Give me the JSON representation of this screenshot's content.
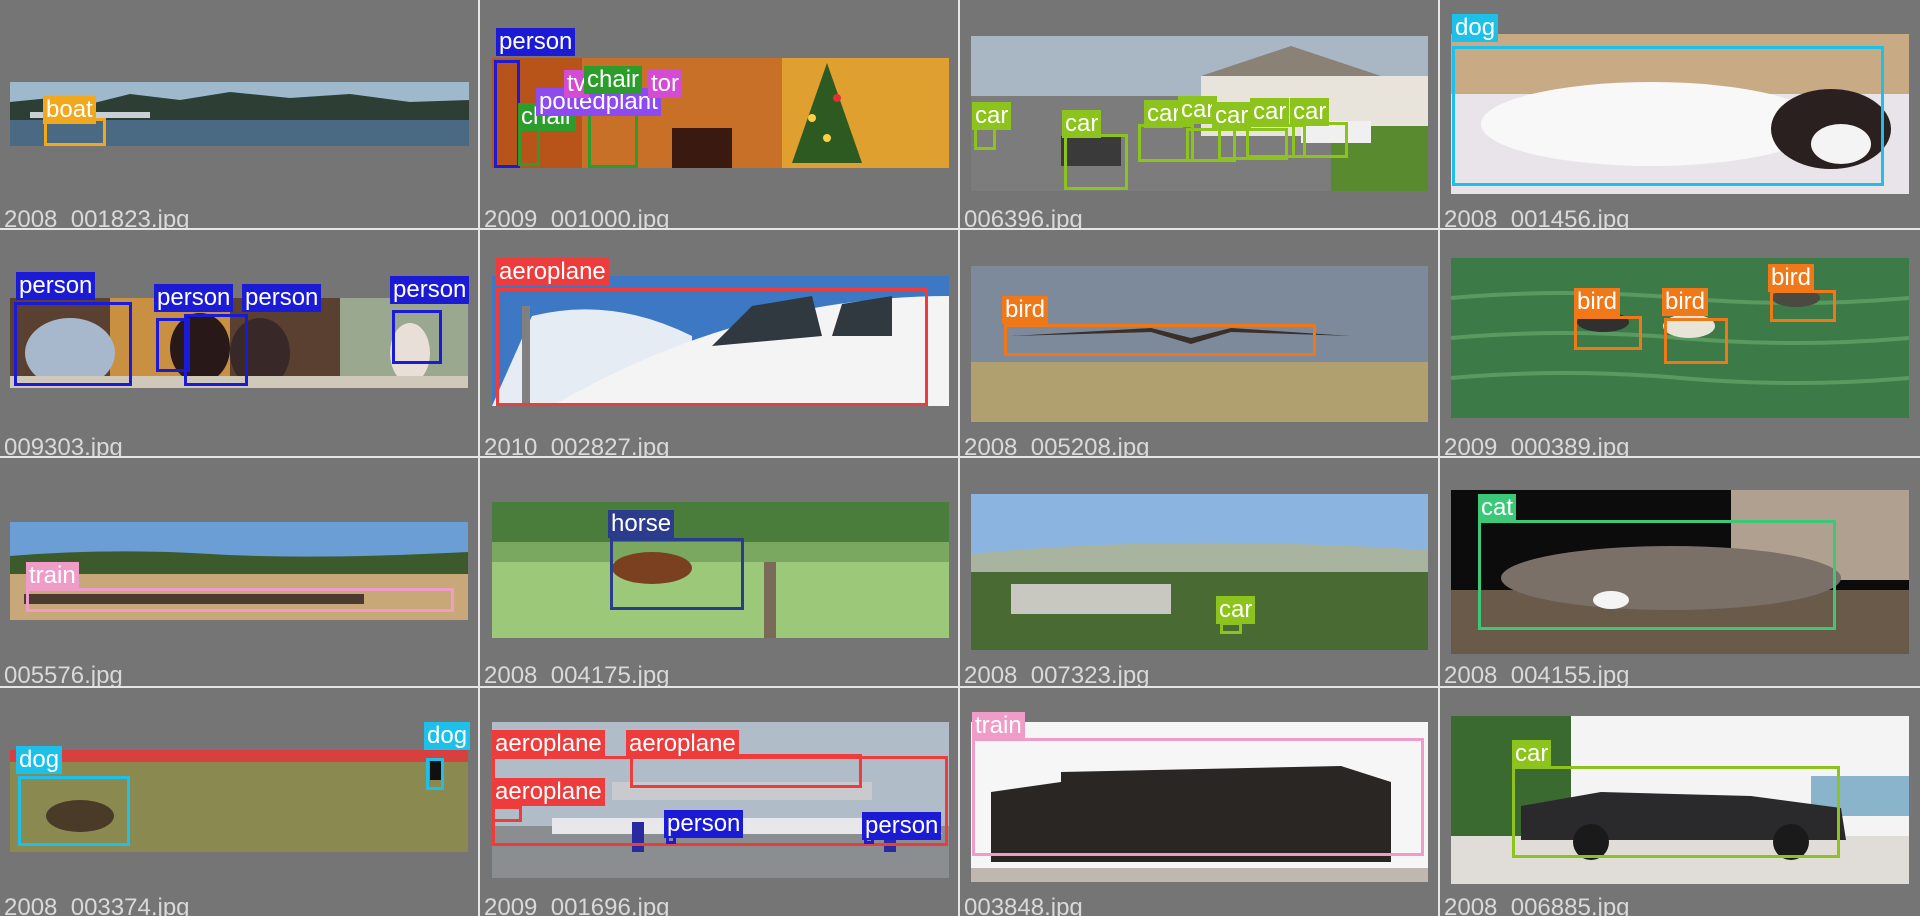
{
  "colors": {
    "person": "#1b1bd6",
    "boat": "#f2a81c",
    "chair": "#2c9c2c",
    "tvmonitor": "#d44bd4",
    "pottedplant": "#8c4af0",
    "car": "#8cc31c",
    "dog": "#1cc0e8",
    "aeroplane": "#ee3c3c",
    "bird": "#f07818",
    "train": "#f09cc8",
    "horse": "#2c3c8c",
    "cat": "#3cc878"
  },
  "cells": [
    {
      "filename": "2008_001823.jpg",
      "scene": "lake-scene",
      "boxes": [
        {
          "label": "boat"
        }
      ]
    },
    {
      "filename": "2009_001000.jpg",
      "scene": "christmas-room-scene",
      "boxes": [
        {
          "label": "person"
        },
        {
          "label": "chair"
        },
        {
          "label": "tv"
        },
        {
          "label": "tor"
        },
        {
          "label": "pottedplant"
        },
        {
          "label": "chair"
        }
      ]
    },
    {
      "filename": "006396.jpg",
      "scene": "street-scene",
      "boxes": [
        {
          "label": "car"
        },
        {
          "label": "car"
        },
        {
          "label": "car"
        },
        {
          "label": "car"
        },
        {
          "label": "car"
        },
        {
          "label": "car"
        },
        {
          "label": "car"
        }
      ]
    },
    {
      "filename": "2008_001456.jpg",
      "scene": "sleeping-dog-scene",
      "boxes": [
        {
          "label": "dog"
        }
      ]
    },
    {
      "filename": "009303.jpg",
      "scene": "cafe-scene",
      "boxes": [
        {
          "label": "person"
        },
        {
          "label": "person"
        },
        {
          "label": "person"
        },
        {
          "label": "person"
        }
      ]
    },
    {
      "filename": "2010_002827.jpg",
      "scene": "jet-nose-scene",
      "boxes": [
        {
          "label": "aeroplane"
        }
      ]
    },
    {
      "filename": "2008_005208.jpg",
      "scene": "flying-bird-scene",
      "boxes": [
        {
          "label": "bird"
        }
      ]
    },
    {
      "filename": "2009_000389.jpg",
      "scene": "ducks-water-scene",
      "boxes": [
        {
          "label": "bird"
        },
        {
          "label": "bird"
        },
        {
          "label": "bird"
        }
      ]
    },
    {
      "filename": "005576.jpg",
      "scene": "train-field-scene",
      "boxes": [
        {
          "label": "train"
        }
      ]
    },
    {
      "filename": "2008_004175.jpg",
      "scene": "horse-meadow-scene",
      "boxes": [
        {
          "label": "horse"
        }
      ]
    },
    {
      "filename": "2008_007323.jpg",
      "scene": "city-valley-scene",
      "boxes": [
        {
          "label": "car"
        }
      ]
    },
    {
      "filename": "2008_004155.jpg",
      "scene": "sleeping-cat-scene",
      "boxes": [
        {
          "label": "cat"
        }
      ]
    },
    {
      "filename": "2008_003374.jpg",
      "scene": "dogs-field-scene",
      "boxes": [
        {
          "label": "dog"
        },
        {
          "label": "dog"
        }
      ]
    },
    {
      "filename": "2009_001696.jpg",
      "scene": "airport-scene",
      "boxes": [
        {
          "label": "aeroplane"
        },
        {
          "label": "aeroplane"
        },
        {
          "label": "aeroplane"
        },
        {
          "label": "person"
        },
        {
          "label": "person"
        }
      ]
    },
    {
      "filename": "003848.jpg",
      "scene": "locomotive-scene",
      "boxes": [
        {
          "label": "train"
        }
      ]
    },
    {
      "filename": "2008_006885.jpg",
      "scene": "convertible-car-scene",
      "boxes": [
        {
          "label": "car"
        }
      ]
    }
  ]
}
